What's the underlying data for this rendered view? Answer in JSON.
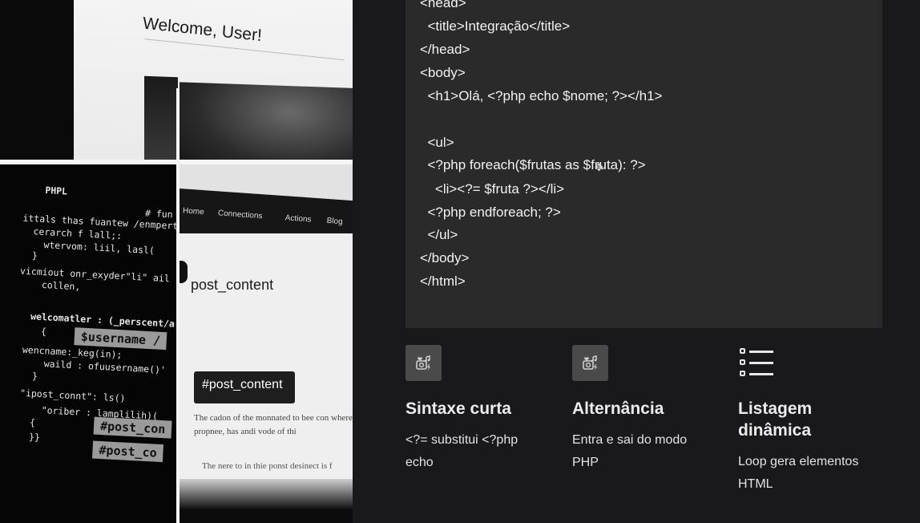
{
  "collage": {
    "welcome_title": "Welcome, User!",
    "code_lines": [
      "PHPL",
      "# fun",
      "ittals thas fuantew /enmpertia",
      "  cerarch f lall;:",
      "    wtervom: liil, lasl(",
      "  }",
      "vicmiout onr_exyder\"li\" ail",
      "    collen,",
      "welcomatler : (_perscent/a",
      "  {",
      "wencname:_keg(in);",
      "    waild : ofuusername()'",
      "  }",
      "\"ipost_connt\": ls()",
      "    \"oriber : lamplilih)(",
      "  {",
      "  }}"
    ],
    "code_highlight_1": "$username /",
    "code_highlight_2": "#post_con",
    "code_highlight_3": "#post_co",
    "nav_items": [
      "Home",
      "Connections",
      "Actions",
      "Blog"
    ],
    "app_heading": "post_content",
    "app_pill": "#post_content",
    "app_para": "The cadon of the monnated to bee con where is propnee, has andi vode of thi",
    "app_para_2": "The nere to in thie ponst desinect is f"
  },
  "code": {
    "lines": [
      "<head>",
      "  <title>Integração</title>",
      "</head>",
      "<body>",
      "  <h1>Olá, <?php echo $nome; ?></h1>",
      "",
      "  <ul>",
      "  <?php foreach($frutas as $fruta): ?>",
      "    <li><?= $fruta ?></li>",
      "  <?php endforeach; ?>",
      "  </ul>",
      "</body>",
      "</html>"
    ]
  },
  "features": [
    {
      "icon": "media-icon",
      "title": "Sintaxe curta",
      "desc_line1": "<?= substitui <?php",
      "desc_line2": "echo"
    },
    {
      "icon": "media-icon",
      "title": "Alternância",
      "desc_line1": "Entra e sai do modo",
      "desc_line2": "PHP"
    },
    {
      "icon": "list-icon",
      "title_line1": "Listagem",
      "title_line2": "dinâmica",
      "desc_line1": "Loop gera elementos",
      "desc_line2": "HTML"
    }
  ],
  "colors": {
    "page_bg": "#19191b",
    "code_bg": "#2a2a2a",
    "icon_bg": "#4a4a4a",
    "text": "#f2f2f2"
  }
}
